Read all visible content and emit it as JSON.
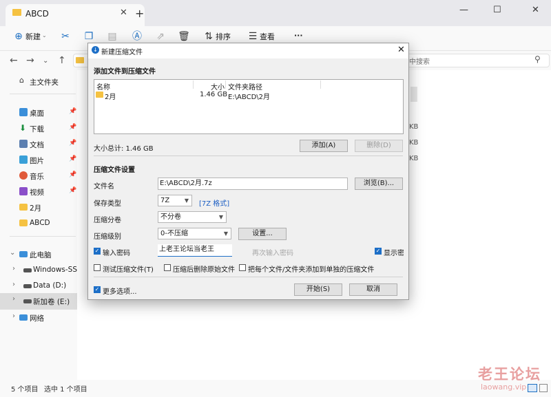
{
  "explorer": {
    "tab_title": "ABCD",
    "toolbar": {
      "new_label": "新建",
      "sort_label": "排序",
      "view_label": "查看",
      "more_label": "···"
    },
    "search_placeholder": "中搜索",
    "sidebar": {
      "home": "主文件夹",
      "pinned": [
        {
          "label": "桌面"
        },
        {
          "label": "下载"
        },
        {
          "label": "文档"
        },
        {
          "label": "图片"
        },
        {
          "label": "音乐"
        },
        {
          "label": "视频"
        },
        {
          "label": "2月"
        },
        {
          "label": "ABCD"
        }
      ],
      "this_pc": "此电脑",
      "drives": [
        {
          "label": "Windows-SSD ("
        },
        {
          "label": "Data (D:)"
        },
        {
          "label": "新加卷 (E:)"
        }
      ],
      "network": "网络"
    },
    "size_suffix": [
      "KB",
      "KB",
      "KB"
    ],
    "status_count": "5 个项目",
    "status_selected": "选中 1 个项目",
    "watermark_cn": "老王论坛",
    "watermark_en": "laowang.vip"
  },
  "dialog": {
    "title": "新建压缩文件",
    "add_section": "添加文件到压缩文件",
    "columns": [
      "名称",
      "大小",
      "文件夹路径"
    ],
    "rows": [
      {
        "name": "2月",
        "size": "1.46 GB",
        "path": "E:\\ABCD\\2月"
      }
    ],
    "total_size": "大小总计: 1.46 GB",
    "add_button": "添加(A)",
    "remove_button": "删除(D)",
    "settings_section": "压缩文件设置",
    "filename_label": "文件名",
    "filename_value": "E:\\ABCD\\2月.7z",
    "browse_button": "浏览(B)...",
    "save_type_label": "保存类型",
    "save_type_value": "7Z",
    "save_type_link": "[7Z 格式]",
    "split_label": "压缩分卷",
    "split_value": "不分卷",
    "level_label": "压缩级别",
    "level_value": "0-不压缩",
    "settings_button": "设置...",
    "password_label": "输入密码",
    "password_value": "上老王论坛当老王",
    "password_repeat_placeholder": "再次输入密码",
    "show_password_label": "显示密码",
    "test_label": "测试压缩文件(T)",
    "delete_after_label": "压缩后删除原始文件",
    "separate_label": "把每个文件/文件夹添加到单独的压缩文件",
    "more_options_label": "更多选项...",
    "start_button": "开始(S)",
    "cancel_button": "取消"
  }
}
